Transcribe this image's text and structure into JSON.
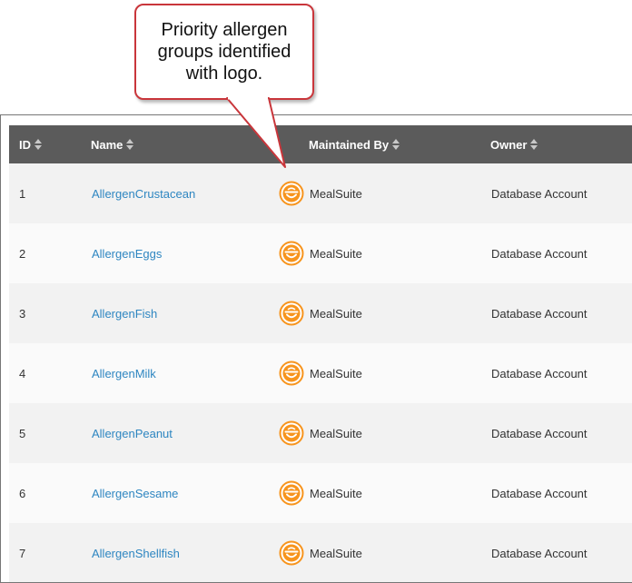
{
  "callout": {
    "lines": [
      "Priority allergen",
      "groups identified",
      "with logo."
    ]
  },
  "table": {
    "headers": {
      "id": "ID",
      "name": "Name",
      "maintained_by": "Maintained By",
      "owner": "Owner"
    },
    "rows": [
      {
        "id": "1",
        "name": "AllergenCrustacean",
        "maintained_by": "MealSuite",
        "owner": "Database Account"
      },
      {
        "id": "2",
        "name": "AllergenEggs",
        "maintained_by": "MealSuite",
        "owner": "Database Account"
      },
      {
        "id": "3",
        "name": "AllergenFish",
        "maintained_by": "MealSuite",
        "owner": "Database Account"
      },
      {
        "id": "4",
        "name": "AllergenMilk",
        "maintained_by": "MealSuite",
        "owner": "Database Account"
      },
      {
        "id": "5",
        "name": "AllergenPeanut",
        "maintained_by": "MealSuite",
        "owner": "Database Account"
      },
      {
        "id": "6",
        "name": "AllergenSesame",
        "maintained_by": "MealSuite",
        "owner": "Database Account"
      },
      {
        "id": "7",
        "name": "AllergenShellfish",
        "maintained_by": "MealSuite",
        "owner": "Database Account"
      }
    ]
  },
  "icons": {
    "sort": "sort-icon",
    "logo": "mealsuite-logo-icon"
  },
  "colors": {
    "header_bg": "#5b5b5b",
    "link": "#2e86c1",
    "logo_orange": "#f7941d",
    "callout_border": "#c9363b"
  }
}
